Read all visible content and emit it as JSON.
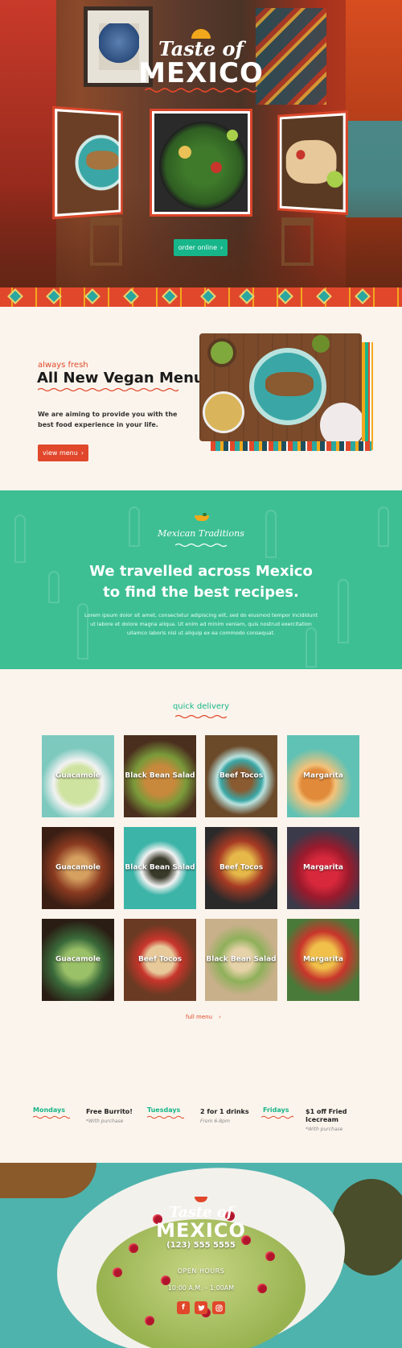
{
  "hero": {
    "logo_top": "Taste of",
    "logo_bottom": "MEXICO",
    "order_button": "order online"
  },
  "vegan": {
    "kicker": "always fresh",
    "title": "All New Vegan Menu",
    "description": "We are aiming to provide you with the best food experience in your life.",
    "button": "view menu"
  },
  "traditions": {
    "kicker": "Mexican Traditions",
    "heading_line1": "We travelled across Mexico",
    "heading_line2": "to find the best recipes.",
    "paragraph": "Lorem ipsum dolor sit amet, consectetur adipiscing elit, sed do eiusmod tempor incididunt ut labore et dolore magna aliqua. Ut enim ad minim veniam, quis nostrud exercitation ullamco laboris nisi ut aliquip ex ea commodo consequat."
  },
  "delivery": {
    "kicker": "quick delivery",
    "items": [
      "Guacamole",
      "Black Bean Salad",
      "Beef Tocos",
      "Margarita",
      "Guacamole",
      "Black Bean Salad",
      "Beef Tocos",
      "Margarita",
      "Guacamole",
      "Beef Tocos",
      "Black Bean Salad",
      "Margarita"
    ],
    "full_menu": "full menu"
  },
  "specials": [
    {
      "day": "Mondays",
      "deal": "Free Burrito!",
      "note": "*With purchase"
    },
    {
      "day": "Tuesdays",
      "deal": "2 for 1 drinks",
      "note": "From 6-8pm"
    },
    {
      "day": "Fridays",
      "deal": "$1 off Fried Icecream",
      "note": "*With purchase"
    }
  ],
  "footer": {
    "logo_top": "Taste of",
    "logo_bottom": "MEXICO",
    "phone": "(123) 555 5555",
    "hours_label": "OPEN HOURS",
    "hours": "10:00 A.M. – 1:00AM"
  },
  "icons": {
    "facebook": "f",
    "twitter": "twitter-bird",
    "instagram": "instagram-camera",
    "arrow": "›"
  },
  "colors": {
    "accent_red": "#e1482b",
    "accent_green": "#17b68a",
    "accent_yellow": "#f2a81c",
    "teal_section": "#3dbf93",
    "cream": "#fbf4ec"
  }
}
